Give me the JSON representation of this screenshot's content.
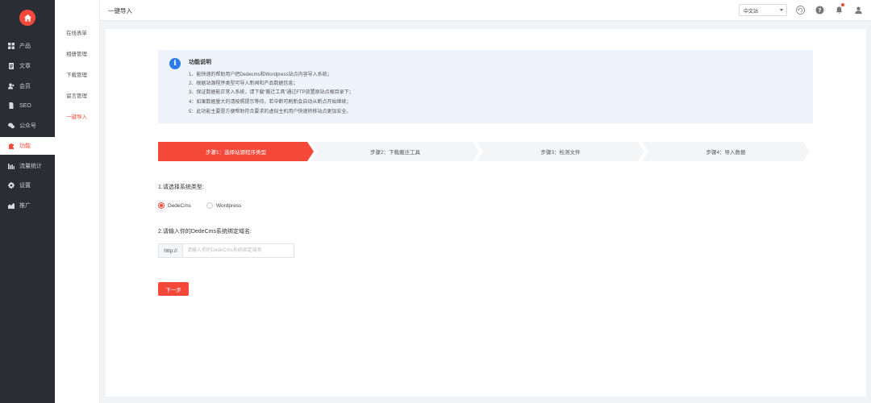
{
  "sidebar": {
    "items": [
      {
        "label": "产品",
        "icon": "grid-icon"
      },
      {
        "label": "文章",
        "icon": "document-icon"
      },
      {
        "label": "会员",
        "icon": "users-icon"
      },
      {
        "label": "SEO",
        "icon": "file-icon"
      },
      {
        "label": "公众号",
        "icon": "wechat-icon"
      },
      {
        "label": "功能",
        "icon": "puzzle-icon",
        "active": true
      },
      {
        "label": "流量统计",
        "icon": "bar-chart-icon"
      },
      {
        "label": "设置",
        "icon": "gear-icon"
      },
      {
        "label": "推广",
        "icon": "chart-icon"
      }
    ]
  },
  "subnav": {
    "items": [
      "在线表单",
      "相册管理",
      "下载管理",
      "留言管理",
      "一键导入"
    ],
    "active_index": 4
  },
  "header": {
    "title": "一键导入",
    "language": "中文站"
  },
  "info": {
    "title": "功能说明",
    "lines": [
      "1、能快速的帮助用户把Dedecms和Wordpress站点内容导入系统；",
      "2、根据站源程序类型可导入新闻和产品数据信息；",
      "3、保证数据能正常入系统，请下载“搬迁工具”通过FTP放置原站点根目录下；",
      "4：如果数据量大的请按照提示等待，若中断可刷新会自动从断点开始继续；",
      "5：此功能主要是方便帮助符合要求的虚拟主机用户快速转移站点更加安全。"
    ]
  },
  "steps": [
    {
      "label": "步骤1：选择站源程序类型",
      "active": true
    },
    {
      "label": "步骤2：下载搬迁工具",
      "active": false
    },
    {
      "label": "步骤3：检测文件",
      "active": false
    },
    {
      "label": "步骤4：导入数据",
      "active": false
    }
  ],
  "form": {
    "q1_label": "1.请选择系统类型:",
    "options": [
      "DedeCms",
      "Wordpress"
    ],
    "selected_option": "DedeCms",
    "q2_label": "2.请输入你的DedeCms系统绑定域名:",
    "url_prefix": "http://",
    "url_placeholder": "请输入你的DedeCms系统绑定域名",
    "next_button": "下一步"
  },
  "colors": {
    "accent": "#f4493a",
    "sidebar_bg": "#2b2d35",
    "info_icon": "#2d7be5"
  }
}
